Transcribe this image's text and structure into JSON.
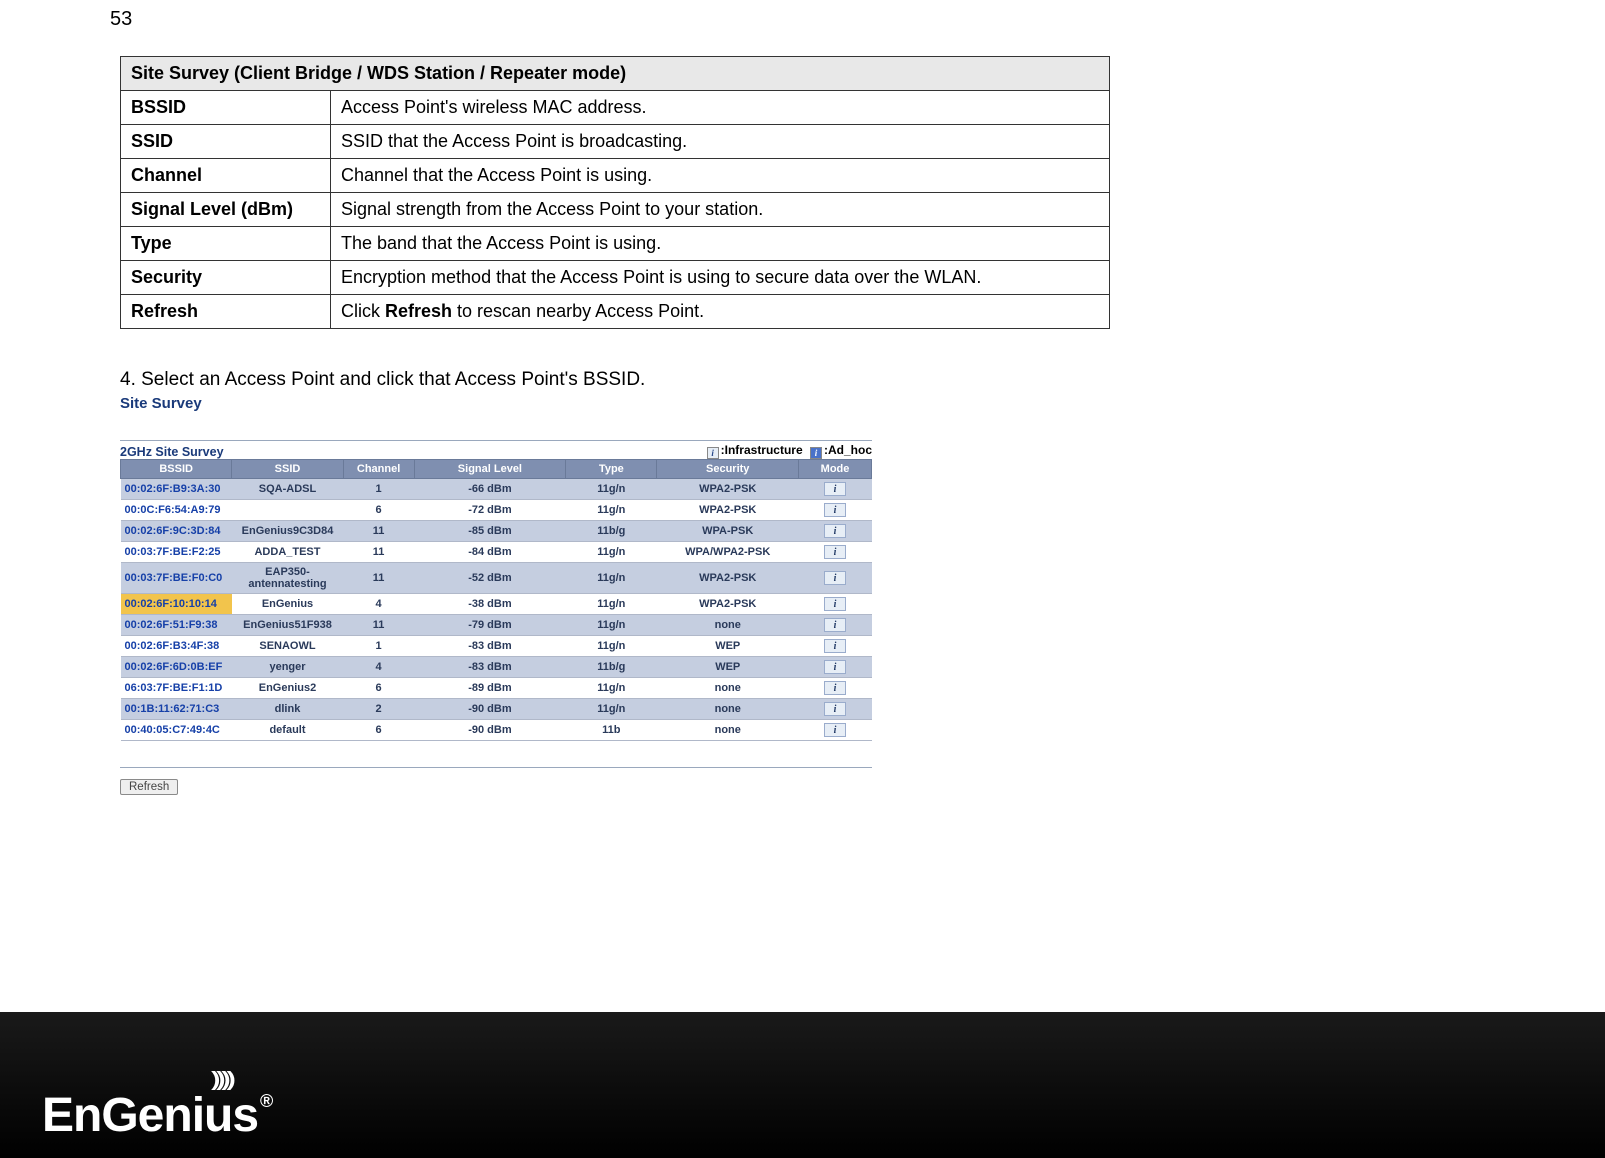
{
  "page_number": "53",
  "definitions": {
    "title": "Site Survey (Client Bridge / WDS Station / Repeater mode)",
    "rows": [
      {
        "key": "BSSID",
        "desc": "Access Point's wireless MAC address."
      },
      {
        "key": "SSID",
        "desc": "SSID that the Access Point is broadcasting."
      },
      {
        "key": "Channel",
        "desc": "Channel that the Access Point is using."
      },
      {
        "key": "Signal Level (dBm)",
        "desc": "Signal strength from the Access Point to your station."
      },
      {
        "key": "Type",
        "desc": "The band that the Access Point is using."
      },
      {
        "key": "Security",
        "desc": "Encryption method that the Access Point is using to secure data over the WLAN."
      },
      {
        "key": "Refresh",
        "desc_pre": "Click ",
        "desc_bold": "Refresh",
        "desc_post": " to rescan nearby Access Point."
      }
    ]
  },
  "step_text": "4. Select an Access Point and click that Access Point's BSSID.",
  "survey": {
    "title": "Site Survey",
    "band_label": "2GHz Site Survey",
    "legend_infra": ":Infrastructure",
    "legend_adhoc": ":Ad_hoc",
    "headers": [
      "BSSID",
      "SSID",
      "Channel",
      "Signal Level",
      "Type",
      "Security",
      "Mode"
    ],
    "selected_index": 5,
    "rows": [
      {
        "bssid": "00:02:6F:B9:3A:30",
        "ssid": "SQA-ADSL",
        "channel": "1",
        "signal": "-66 dBm",
        "type": "11g/n",
        "security": "WPA2-PSK",
        "mode": "i"
      },
      {
        "bssid": "00:0C:F6:54:A9:79",
        "ssid": "",
        "channel": "6",
        "signal": "-72 dBm",
        "type": "11g/n",
        "security": "WPA2-PSK",
        "mode": "i"
      },
      {
        "bssid": "00:02:6F:9C:3D:84",
        "ssid": "EnGenius9C3D84",
        "channel": "11",
        "signal": "-85 dBm",
        "type": "11b/g",
        "security": "WPA-PSK",
        "mode": "i"
      },
      {
        "bssid": "00:03:7F:BE:F2:25",
        "ssid": "ADDA_TEST",
        "channel": "11",
        "signal": "-84 dBm",
        "type": "11g/n",
        "security": "WPA/WPA2-PSK",
        "mode": "i"
      },
      {
        "bssid": "00:03:7F:BE:F0:C0",
        "ssid": "EAP350-antennatesting",
        "channel": "11",
        "signal": "-52 dBm",
        "type": "11g/n",
        "security": "WPA2-PSK",
        "mode": "i"
      },
      {
        "bssid": "00:02:6F:10:10:14",
        "ssid": "EnGenius",
        "channel": "4",
        "signal": "-38 dBm",
        "type": "11g/n",
        "security": "WPA2-PSK",
        "mode": "i"
      },
      {
        "bssid": "00:02:6F:51:F9:38",
        "ssid": "EnGenius51F938",
        "channel": "11",
        "signal": "-79 dBm",
        "type": "11g/n",
        "security": "none",
        "mode": "i"
      },
      {
        "bssid": "00:02:6F:B3:4F:38",
        "ssid": "SENAOWL",
        "channel": "1",
        "signal": "-83 dBm",
        "type": "11g/n",
        "security": "WEP",
        "mode": "i"
      },
      {
        "bssid": "00:02:6F:6D:0B:EF",
        "ssid": "yenger",
        "channel": "4",
        "signal": "-83 dBm",
        "type": "11b/g",
        "security": "WEP",
        "mode": "i"
      },
      {
        "bssid": "06:03:7F:BE:F1:1D",
        "ssid": "EnGenius2",
        "channel": "6",
        "signal": "-89 dBm",
        "type": "11g/n",
        "security": "none",
        "mode": "i"
      },
      {
        "bssid": "00:1B:11:62:71:C3",
        "ssid": "dlink",
        "channel": "2",
        "signal": "-90 dBm",
        "type": "11g/n",
        "security": "none",
        "mode": "i"
      },
      {
        "bssid": "00:40:05:C7:49:4C",
        "ssid": "default",
        "channel": "6",
        "signal": "-90 dBm",
        "type": "11b",
        "security": "none",
        "mode": "i"
      }
    ],
    "refresh_label": "Refresh"
  },
  "footer": {
    "brand": "EnGenius",
    "registered": "®"
  }
}
